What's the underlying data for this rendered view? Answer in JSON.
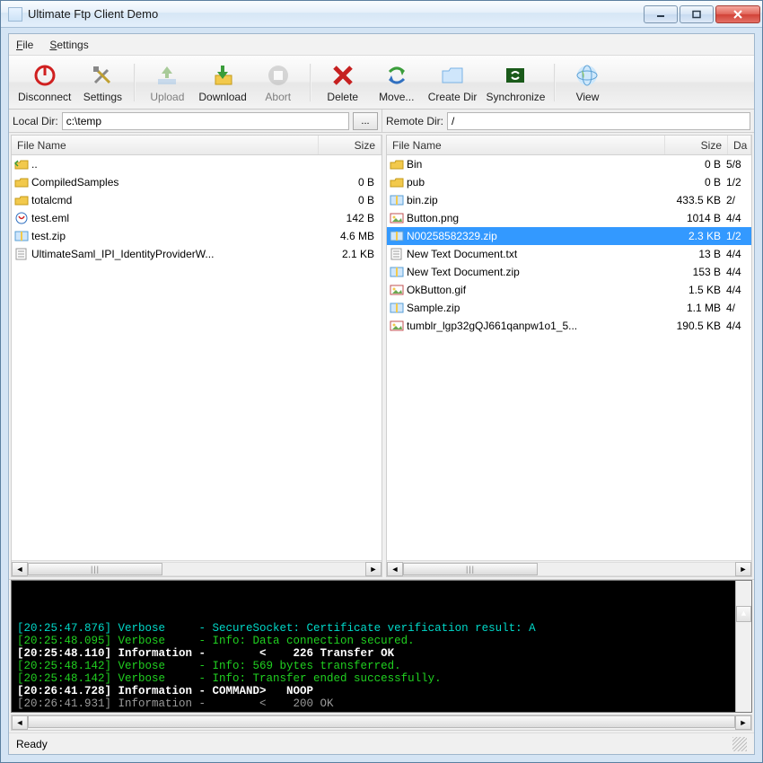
{
  "window": {
    "title": "Ultimate Ftp Client Demo"
  },
  "menu": {
    "file": "File",
    "settings": "Settings"
  },
  "toolbar": {
    "disconnect": "Disconnect",
    "settings": "Settings",
    "upload": "Upload",
    "download": "Download",
    "abort": "Abort",
    "delete": "Delete",
    "move": "Move...",
    "createdir": "Create Dir",
    "sync": "Synchronize",
    "view": "View"
  },
  "local": {
    "label": "Local Dir:",
    "value": "c:\\temp",
    "columns": {
      "name": "File Name",
      "size": "Size"
    },
    "rows": [
      {
        "icon": "up",
        "name": "..",
        "size": ""
      },
      {
        "icon": "folder",
        "name": "CompiledSamples",
        "size": "0 B"
      },
      {
        "icon": "folder",
        "name": "totalcmd",
        "size": "0 B"
      },
      {
        "icon": "eml",
        "name": "test.eml",
        "size": "142 B"
      },
      {
        "icon": "zip",
        "name": "test.zip",
        "size": "4.6 MB"
      },
      {
        "icon": "txt",
        "name": "UltimateSaml_IPI_IdentityProviderW...",
        "size": "2.1 KB"
      }
    ]
  },
  "remote": {
    "label": "Remote Dir:",
    "value": "/",
    "columns": {
      "name": "File Name",
      "size": "Size",
      "date": "Da"
    },
    "rows": [
      {
        "icon": "folder",
        "name": "Bin",
        "size": "0 B",
        "date": "5/8"
      },
      {
        "icon": "folder",
        "name": "pub",
        "size": "0 B",
        "date": "1/2"
      },
      {
        "icon": "zip",
        "name": "bin.zip",
        "size": "433.5 KB",
        "date": "2/"
      },
      {
        "icon": "png",
        "name": "Button.png",
        "size": "1014 B",
        "date": "4/4"
      },
      {
        "icon": "zip",
        "name": "N00258582329.zip",
        "size": "2.3 KB",
        "date": "1/2",
        "selected": true
      },
      {
        "icon": "txt",
        "name": "New Text Document.txt",
        "size": "13 B",
        "date": "4/4"
      },
      {
        "icon": "zip",
        "name": "New Text Document.zip",
        "size": "153 B",
        "date": "4/4"
      },
      {
        "icon": "gif",
        "name": "OkButton.gif",
        "size": "1.5 KB",
        "date": "4/4"
      },
      {
        "icon": "zip",
        "name": "Sample.zip",
        "size": "1.1 MB",
        "date": "4/"
      },
      {
        "icon": "png",
        "name": "tumblr_lgp32gQJ661qanpw1o1_5...",
        "size": "190.5 KB",
        "date": "4/4"
      }
    ]
  },
  "log": [
    {
      "ts": "[20:25:47.876]",
      "lvl": "Verbose",
      "msg": "SecureSocket: Certificate verification result: A",
      "cls": "lg-t"
    },
    {
      "ts": "[20:25:48.095]",
      "lvl": "Verbose",
      "msg": "Info: Data connection secured.",
      "cls": "lg-g"
    },
    {
      "ts": "[20:25:48.110]",
      "lvl": "Information",
      "msg": "       <    226 Transfer OK",
      "cls": "lg-w"
    },
    {
      "ts": "[20:25:48.142]",
      "lvl": "Verbose",
      "msg": "Info: 569 bytes transferred.",
      "cls": "lg-g"
    },
    {
      "ts": "[20:25:48.142]",
      "lvl": "Verbose",
      "msg": "Info: Transfer ended successfully.",
      "cls": "lg-g"
    },
    {
      "ts": "[20:26:41.728]",
      "lvl": "Information",
      "msg": "COMMAND>   NOOP",
      "cls": "lg-w"
    },
    {
      "ts": "[20:26:41.931]",
      "lvl": "Information",
      "msg": "       <    200 OK",
      "cls": "lg-gr"
    }
  ],
  "status": "Ready"
}
